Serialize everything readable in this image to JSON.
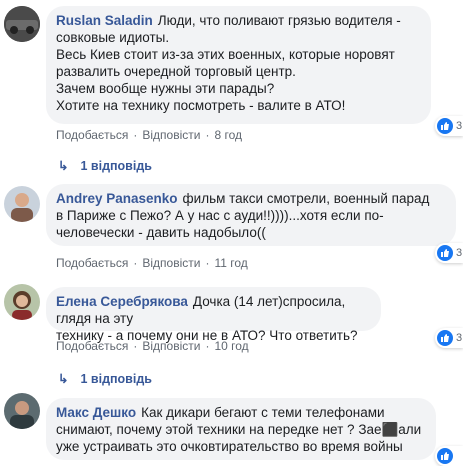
{
  "actions": {
    "like": "Подобається",
    "reply": "Відповісти",
    "separator": "·"
  },
  "comments": [
    {
      "author": "Ruslan Saladin",
      "lines": [
        "Люди, что поливают грязью водителя -",
        "совковые идиоты.",
        "Весь Киев стоит из-за этих военных, которые норовят",
        "развалить очередной торговый центр.",
        "Зачем вообще нужны эти парады?",
        "Хотите на технику посмотреть - валите в АТО!"
      ],
      "time": "8 год",
      "reactions": "3",
      "replies": "1 відповідь"
    },
    {
      "author": "Andrey Panasenko",
      "lines": [
        "фильм такси смотрели, военный парад",
        "в Париже с Пежо? А у нас с ауди!!))))...хотя если по-",
        "человечески - давить надобыло(("
      ],
      "time": "11 год",
      "reactions": "3",
      "replies": ""
    },
    {
      "author": "Елена Серебрякова",
      "lines": [
        "Дочка (14 лет)спросила, глядя на эту",
        "технику - а почему они не в АТО? Что ответить?"
      ],
      "time": "10 год",
      "reactions": "3",
      "replies": "1 відповідь"
    },
    {
      "author": "Макс Дешко",
      "lines": [
        "Как дикари бегают с теми телефонами",
        "снимают, почему этой техники на передке нет ? Зае⬛али",
        "уже устраивать это очковтирательство во время войны"
      ],
      "time": "",
      "reactions": "",
      "replies": ""
    }
  ],
  "colors": {
    "link": "#385898",
    "bubble": "#f2f3f5",
    "meta": "#606770",
    "like": "#1877f2"
  }
}
